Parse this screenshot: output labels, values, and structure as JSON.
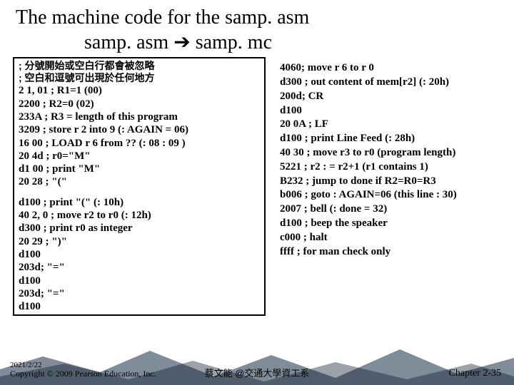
{
  "title": {
    "line1": "The machine code for the samp. asm",
    "line2_a": "samp. asm ",
    "arrow": "➔",
    "line2_b": "   samp. mc"
  },
  "left": {
    "c1": "; 分號開始或空白行都會被忽略",
    "c2": "; 空白和逗號可出現於任何地方",
    "r1": "2 1, 01  ; R1=1  (00)",
    "r2": "2200   ; R2=0   (02)",
    "r3": "233A   ; R3 = length of this program",
    "r4": "3209   ; store r 2 into 9 (: AGAIN = 06)",
    "r5": "16 00  ; LOAD r 6 from  ?? (: 08 : 09 )",
    "r6": "20 4d  ; r0=\"M\"",
    "r7": "d1 00  ; print \"M\"",
    "r8": "20 28  ; \"(\"",
    "r9": "d100  ; print \"(\"   (: 10h)",
    "r10": "40 2, 0  ; move r2 to r0  (: 12h)",
    "r11": "d300   ; print r0 as integer",
    "r12": "20 29 ; \")\"",
    "r13": "d100",
    "r14": "203d; \"=\"",
    "r15": "d100",
    "r16": "203d; \"=\"",
    "r17": "d100"
  },
  "right": {
    "r1": "4060; move r 6 to r 0",
    "r2": "d300 ; out content of mem[r2] (: 20h)",
    "r3": "200d; CR",
    "r4": "d100",
    "r5": "20 0A ; LF",
    "r6": "d100  ; print Line Feed   (: 28h)",
    "r7": "40 30 ; move r3 to r0 (program length)",
    "r8": "5221  ; r2 : = r2+1 (r1 contains 1)",
    "r9": "B232  ; jump to done if R2=R0=R3",
    "r10": "b006  ; goto : AGAIN=06  (this line : 30)",
    "r11": "2007  ; bell (: done = 32)",
    "r12": "d100  ; beep the speaker",
    "r13": "c000  ; halt",
    "r14": "ffff  ; for man check only"
  },
  "footer": {
    "date": "2021/2/22",
    "copy": "Copyright © 2009 Pearson Education, Inc.",
    "center": "蔡文能 @交通大學資工系",
    "right": "Chapter 2-35"
  }
}
